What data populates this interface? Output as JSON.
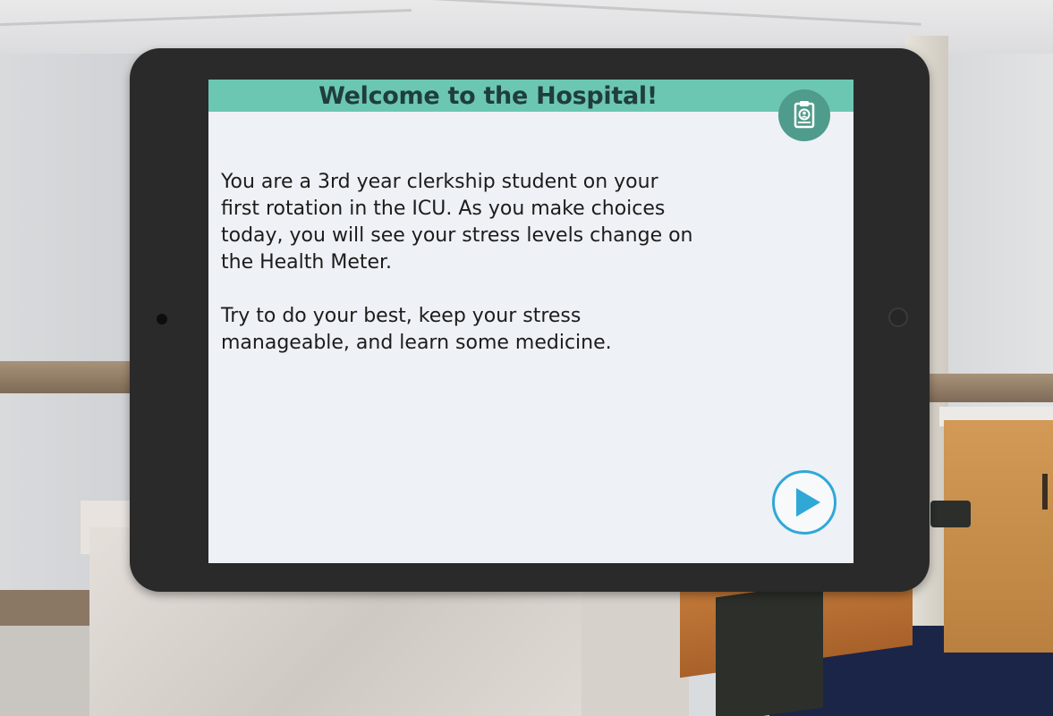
{
  "dialog": {
    "title": "Welcome to the Hospital!",
    "paragraphs": [
      "You are a 3rd year clerkship student on your\nfirst rotation in the ICU.  As you make choices\ntoday, you will see your stress levels change on\nthe Health Meter.",
      "Try to do your best, keep your stress\nmanageable, and learn some medicine."
    ],
    "header_icon": "clipboard-icon",
    "next_icon": "play-icon"
  },
  "colors": {
    "header_bg": "#6cc7b2",
    "header_text": "#1f3e3b",
    "icon_button_bg": "#4f9b8c",
    "next_accent": "#2fa8d8",
    "tablet_bezel": "#2a2a2a",
    "screen_bg": "#eef1f5"
  }
}
